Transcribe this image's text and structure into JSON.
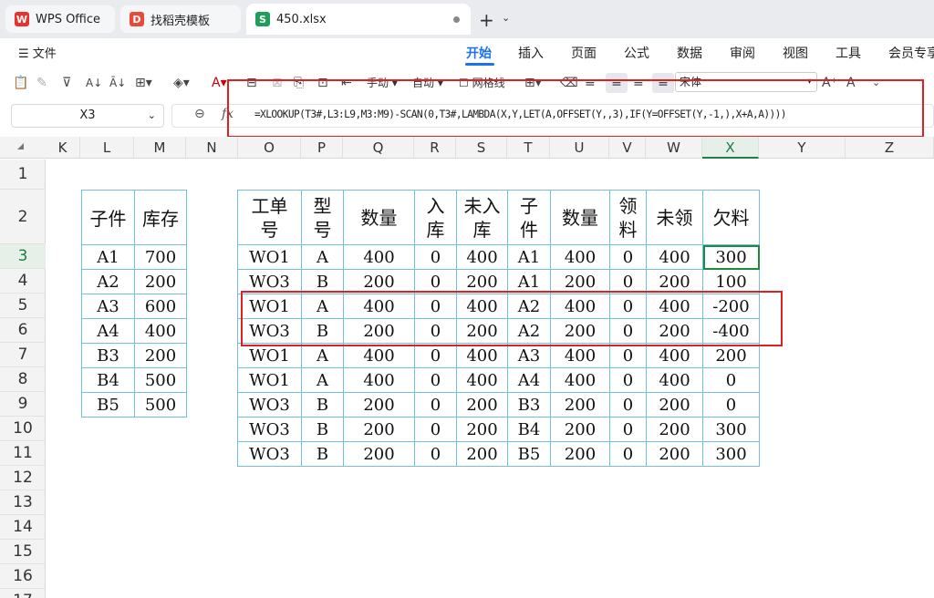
{
  "tabs": {
    "wps_label": "WPS Office",
    "template_label": "找稻壳模板",
    "file_label": "450.xlsx",
    "new_tab": "+",
    "new_tab_dropdown": "⌄"
  },
  "menu": {
    "file": "文件",
    "items": [
      "开始",
      "插入",
      "页面",
      "公式",
      "数据",
      "审阅",
      "视图",
      "工具",
      "会员专享"
    ]
  },
  "toolbar": {
    "calc_mode": "手动",
    "auto_label": "自动",
    "gridlines_label": "网格线",
    "font_name": "宋体"
  },
  "formula_bar": {
    "cell_ref": "X3",
    "fx": "fx",
    "formula": "=XLOOKUP(T3#,L3:L9,M3:M9)-SCAN(0,T3#,LAMBDA(X,Y,LET(A,OFFSET(Y,,3),IF(Y=OFFSET(Y,-1,),X+A,A))))"
  },
  "grid": {
    "columns": [
      "K",
      "L",
      "M",
      "N",
      "O",
      "P",
      "Q",
      "R",
      "S",
      "T",
      "U",
      "V",
      "W",
      "X",
      "Y",
      "Z"
    ],
    "selected_column": "X",
    "rows": [
      "1",
      "2",
      "3",
      "4",
      "5",
      "6",
      "7",
      "8",
      "9",
      "10",
      "11",
      "12",
      "13",
      "14",
      "15",
      "16",
      "17"
    ],
    "selected_row": "3"
  },
  "left_table": {
    "headers": [
      "子件",
      "库存"
    ],
    "rows": [
      [
        "A1",
        "700"
      ],
      [
        "A2",
        "200"
      ],
      [
        "A3",
        "600"
      ],
      [
        "A4",
        "400"
      ],
      [
        "B3",
        "200"
      ],
      [
        "B4",
        "500"
      ],
      [
        "B5",
        "500"
      ]
    ]
  },
  "main_table": {
    "headers": [
      "工单号",
      "型号",
      "数量",
      "入库",
      "未入库",
      "子件",
      "数量",
      "领料",
      "未领",
      "欠料"
    ],
    "rows": [
      [
        "WO1",
        "A",
        "400",
        "0",
        "400",
        "A1",
        "400",
        "0",
        "400",
        "300"
      ],
      [
        "WO3",
        "B",
        "200",
        "0",
        "200",
        "A1",
        "200",
        "0",
        "200",
        "100"
      ],
      [
        "WO1",
        "A",
        "400",
        "0",
        "400",
        "A2",
        "400",
        "0",
        "400",
        "-200"
      ],
      [
        "WO3",
        "B",
        "200",
        "0",
        "200",
        "A2",
        "200",
        "0",
        "200",
        "-400"
      ],
      [
        "WO1",
        "A",
        "400",
        "0",
        "400",
        "A3",
        "400",
        "0",
        "400",
        "200"
      ],
      [
        "WO1",
        "A",
        "400",
        "0",
        "400",
        "A4",
        "400",
        "0",
        "400",
        "0"
      ],
      [
        "WO3",
        "B",
        "200",
        "0",
        "200",
        "B3",
        "200",
        "0",
        "200",
        "0"
      ],
      [
        "WO3",
        "B",
        "200",
        "0",
        "200",
        "B4",
        "200",
        "0",
        "200",
        "300"
      ],
      [
        "WO3",
        "B",
        "200",
        "0",
        "200",
        "B5",
        "200",
        "0",
        "200",
        "300"
      ]
    ]
  },
  "colors": {
    "accent": "#1a73e8",
    "selection": "#1e8a3e",
    "highlight_box": "#e02020",
    "table_border": "#6fc0e8"
  }
}
